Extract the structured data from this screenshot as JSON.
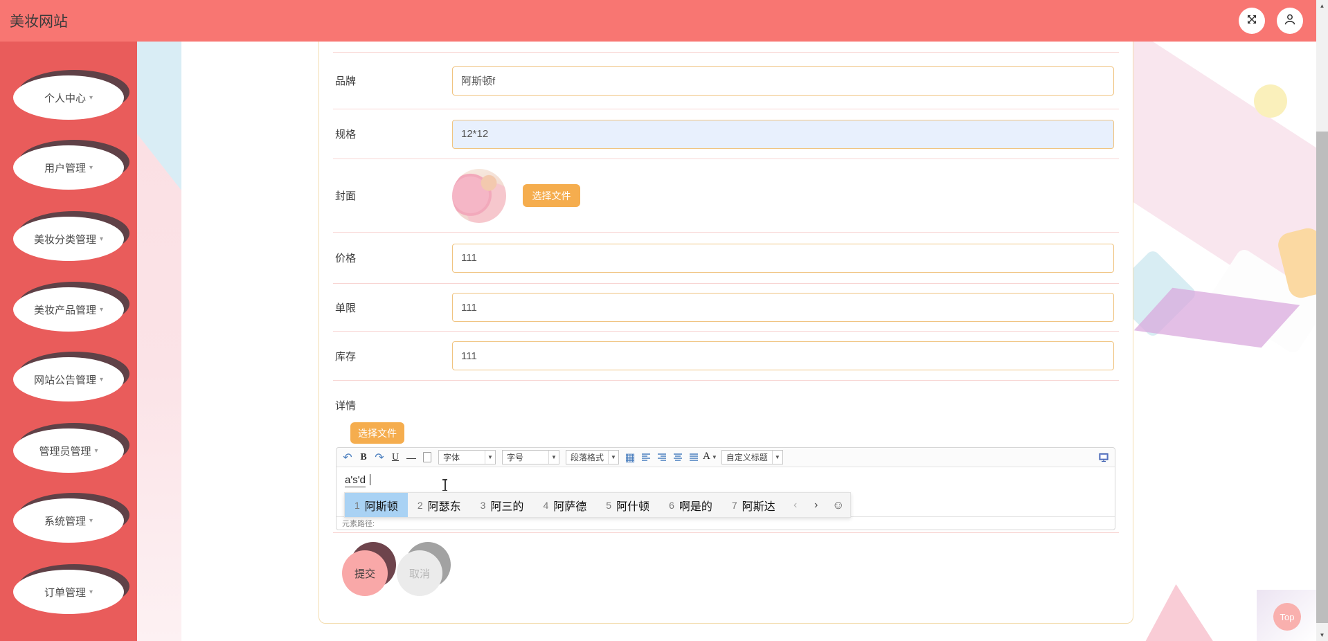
{
  "header": {
    "title": "美妆网站"
  },
  "sidebar": {
    "items": [
      {
        "label": "个人中心"
      },
      {
        "label": "用户管理"
      },
      {
        "label": "美妆分类管理"
      },
      {
        "label": "美妆产品管理"
      },
      {
        "label": "网站公告管理"
      },
      {
        "label": "管理员管理"
      },
      {
        "label": "系统管理"
      },
      {
        "label": "订单管理"
      }
    ]
  },
  "form": {
    "rows": [
      {
        "label": "品牌",
        "value": "阿斯顿f"
      },
      {
        "label": "规格",
        "value": "12*12"
      },
      {
        "label": "封面",
        "button": "选择文件"
      },
      {
        "label": "价格",
        "value": "111"
      },
      {
        "label": "单限",
        "value": "111"
      },
      {
        "label": "库存",
        "value": "111"
      }
    ],
    "detail": {
      "label": "详情",
      "upload_button": "选择文件",
      "toolbar": {
        "bold": "B",
        "underline": "U",
        "hr": "—",
        "font_dropdown": "字体",
        "size_dropdown": "字号",
        "paragraph_dropdown": "段落格式",
        "color_letter": "A",
        "custom_title_dropdown": "自定义标题"
      },
      "content": "a's'd",
      "status": "元素路径:"
    },
    "submit_label": "提交",
    "cancel_label": "取消"
  },
  "ime": {
    "candidates": [
      {
        "n": "1",
        "t": "阿斯顿",
        "selected": true
      },
      {
        "n": "2",
        "t": "阿瑟东"
      },
      {
        "n": "3",
        "t": "阿三的"
      },
      {
        "n": "4",
        "t": "阿萨德"
      },
      {
        "n": "5",
        "t": "阿什顿"
      },
      {
        "n": "6",
        "t": "啊是的"
      },
      {
        "n": "7",
        "t": "阿斯达"
      }
    ],
    "prev": "‹",
    "next": "›",
    "smiley": "☺"
  },
  "icons": {
    "caret_down": "▾",
    "dropdown_arrow": "▼",
    "undo": "↶",
    "redo": "↷",
    "table": "▦",
    "scroll_up": "▲",
    "scroll_down": "▼"
  },
  "misc": {
    "top_button": "Top"
  },
  "colors": {
    "header_bg": "#f87672",
    "sidebar_bg": "#e95c5b",
    "oval_shadow": "#5f4147",
    "accent_orange": "#f5ad4e",
    "input_border": "#f0c481",
    "row_separator": "#f8d5d3",
    "card_border": "#f3dcae",
    "ime_highlight": "#a9d2f4",
    "submit_pink": "#f9a8a8"
  }
}
